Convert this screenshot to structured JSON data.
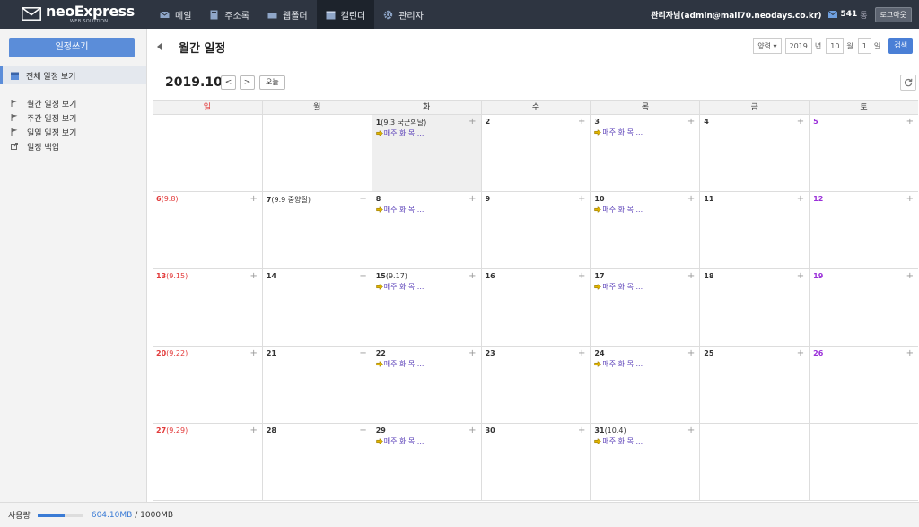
{
  "app": {
    "brand": "neoExpress",
    "brand_sub": "WEB SOLUTION",
    "nav": [
      {
        "label": "메일",
        "icon": "mail-icon",
        "active": false
      },
      {
        "label": "주소록",
        "icon": "address-book-icon",
        "active": false
      },
      {
        "label": "웹폴더",
        "icon": "folder-icon",
        "active": false
      },
      {
        "label": "캘린더",
        "icon": "calendar-icon",
        "active": true
      },
      {
        "label": "관리자",
        "icon": "gear-icon",
        "active": false
      }
    ],
    "user": "관리자님(admin@mail70.neodays.co.kr)",
    "mail_count": "541",
    "mail_unit": "통",
    "logout": "로그아웃"
  },
  "sidebar": {
    "write_button": "일정쓰기",
    "all_view": "전체 일정 보기",
    "items": [
      {
        "label": "월간 일정 보기",
        "icon": "flag-icon"
      },
      {
        "label": "주간 일정 보기",
        "icon": "flag-icon"
      },
      {
        "label": "일일 일정 보기",
        "icon": "flag-icon"
      },
      {
        "label": "일정 백업",
        "icon": "export-icon"
      }
    ]
  },
  "header": {
    "title": "월간 일정",
    "calendar_type": "양력",
    "year": "2019",
    "year_unit": "년",
    "month": "10",
    "month_unit": "월",
    "day": "1",
    "day_unit": "일",
    "search_button": "검색"
  },
  "calendar": {
    "month_label": "2019.10",
    "prev": "<",
    "next": ">",
    "today_button": "오늘",
    "weekdays": [
      "일",
      "월",
      "화",
      "수",
      "목",
      "금",
      "토"
    ],
    "event_text": "매주 화 목 ...",
    "weeks": [
      [
        {
          "day": "",
          "lunar": "",
          "event": false,
          "today": false
        },
        {
          "day": "",
          "lunar": "",
          "event": false,
          "today": false
        },
        {
          "day": "1",
          "lunar": "(9.3 국군의날)",
          "event": true,
          "today": true
        },
        {
          "day": "2",
          "lunar": "",
          "event": false,
          "today": false
        },
        {
          "day": "3",
          "lunar": "",
          "event": true,
          "today": false
        },
        {
          "day": "4",
          "lunar": "",
          "event": false,
          "today": false
        },
        {
          "day": "5",
          "lunar": "",
          "event": false,
          "today": false
        }
      ],
      [
        {
          "day": "6",
          "lunar": "(9.8)",
          "event": false,
          "today": false
        },
        {
          "day": "7",
          "lunar": "(9.9 중양절)",
          "event": false,
          "today": false
        },
        {
          "day": "8",
          "lunar": "",
          "event": true,
          "today": false
        },
        {
          "day": "9",
          "lunar": "",
          "event": false,
          "today": false
        },
        {
          "day": "10",
          "lunar": "",
          "event": true,
          "today": false
        },
        {
          "day": "11",
          "lunar": "",
          "event": false,
          "today": false
        },
        {
          "day": "12",
          "lunar": "",
          "event": false,
          "today": false
        }
      ],
      [
        {
          "day": "13",
          "lunar": "(9.15)",
          "event": false,
          "today": false
        },
        {
          "day": "14",
          "lunar": "",
          "event": false,
          "today": false
        },
        {
          "day": "15",
          "lunar": "(9.17)",
          "event": true,
          "today": false
        },
        {
          "day": "16",
          "lunar": "",
          "event": false,
          "today": false
        },
        {
          "day": "17",
          "lunar": "",
          "event": true,
          "today": false
        },
        {
          "day": "18",
          "lunar": "",
          "event": false,
          "today": false
        },
        {
          "day": "19",
          "lunar": "",
          "event": false,
          "today": false
        }
      ],
      [
        {
          "day": "20",
          "lunar": "(9.22)",
          "event": false,
          "today": false
        },
        {
          "day": "21",
          "lunar": "",
          "event": false,
          "today": false
        },
        {
          "day": "22",
          "lunar": "",
          "event": true,
          "today": false
        },
        {
          "day": "23",
          "lunar": "",
          "event": false,
          "today": false
        },
        {
          "day": "24",
          "lunar": "",
          "event": true,
          "today": false
        },
        {
          "day": "25",
          "lunar": "",
          "event": false,
          "today": false
        },
        {
          "day": "26",
          "lunar": "",
          "event": false,
          "today": false
        }
      ],
      [
        {
          "day": "27",
          "lunar": "(9.29)",
          "event": false,
          "today": false
        },
        {
          "day": "28",
          "lunar": "",
          "event": false,
          "today": false
        },
        {
          "day": "29",
          "lunar": "",
          "event": true,
          "today": false
        },
        {
          "day": "30",
          "lunar": "",
          "event": false,
          "today": false
        },
        {
          "day": "31",
          "lunar": "(10.4)",
          "event": true,
          "today": false
        },
        {
          "day": "",
          "lunar": "",
          "event": false,
          "today": false
        },
        {
          "day": "",
          "lunar": "",
          "event": false,
          "today": false
        }
      ]
    ]
  },
  "footer": {
    "label": "사용량",
    "used": "604.10MB",
    "total": "/ 1000MB",
    "usage_fraction": 0.604
  },
  "colors": {
    "topbar": "#2e3541",
    "accent": "#5b8dd9",
    "sunday": "#e23a3a",
    "saturday": "#9b30d9",
    "event": "#5a3fb8"
  }
}
